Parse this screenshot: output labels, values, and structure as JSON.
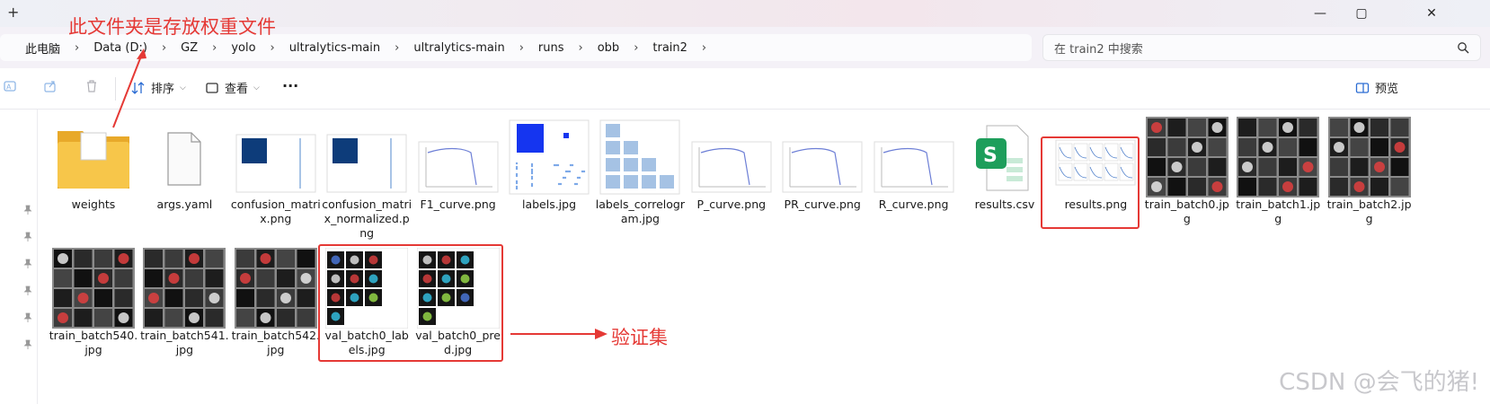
{
  "titlebar": {
    "new_tab": "+",
    "minimize": "—",
    "maximize": "▢",
    "close": "✕"
  },
  "breadcrumb": [
    "此电脑",
    "Data (D:)",
    "GZ",
    "yolo",
    "ultralytics-main",
    "ultralytics-main",
    "runs",
    "obb",
    "train2"
  ],
  "search": {
    "placeholder": "在 train2 中搜索"
  },
  "toolbar": {
    "sort_label": "排序",
    "view_label": "查看",
    "more": "···",
    "preview_label": "预览"
  },
  "files": [
    {
      "name": "weights",
      "kind": "folder"
    },
    {
      "name": "args.yaml",
      "kind": "doc"
    },
    {
      "name": "confusion_matrix.png",
      "kind": "matrix"
    },
    {
      "name": "confusion_matrix_normalized.png",
      "kind": "matrix"
    },
    {
      "name": "F1_curve.png",
      "kind": "curve"
    },
    {
      "name": "labels.jpg",
      "kind": "labels"
    },
    {
      "name": "labels_correlogram.jpg",
      "kind": "correlogram"
    },
    {
      "name": "P_curve.png",
      "kind": "curve"
    },
    {
      "name": "PR_curve.png",
      "kind": "curve"
    },
    {
      "name": "R_curve.png",
      "kind": "curve"
    },
    {
      "name": "results.csv",
      "kind": "csv"
    },
    {
      "name": "results.png",
      "kind": "results"
    },
    {
      "name": "train_batch0.jpg",
      "kind": "batch"
    },
    {
      "name": "train_batch1.jpg",
      "kind": "batch"
    },
    {
      "name": "train_batch2.jpg",
      "kind": "batch"
    },
    {
      "name": "train_batch540.jpg",
      "kind": "batch"
    },
    {
      "name": "train_batch541.jpg",
      "kind": "batch"
    },
    {
      "name": "train_batch542.jpg",
      "kind": "batch"
    },
    {
      "name": "val_batch0_labels.jpg",
      "kind": "val"
    },
    {
      "name": "val_batch0_pred.jpg",
      "kind": "val"
    }
  ],
  "annotations": {
    "top": "此文件夹是存放权重文件",
    "val": "验证集"
  },
  "watermark": "CSDN @会飞的猪!",
  "colors": {
    "accent": "#e53935",
    "folder": "#f5c142",
    "csv": "#1e9e5b"
  }
}
